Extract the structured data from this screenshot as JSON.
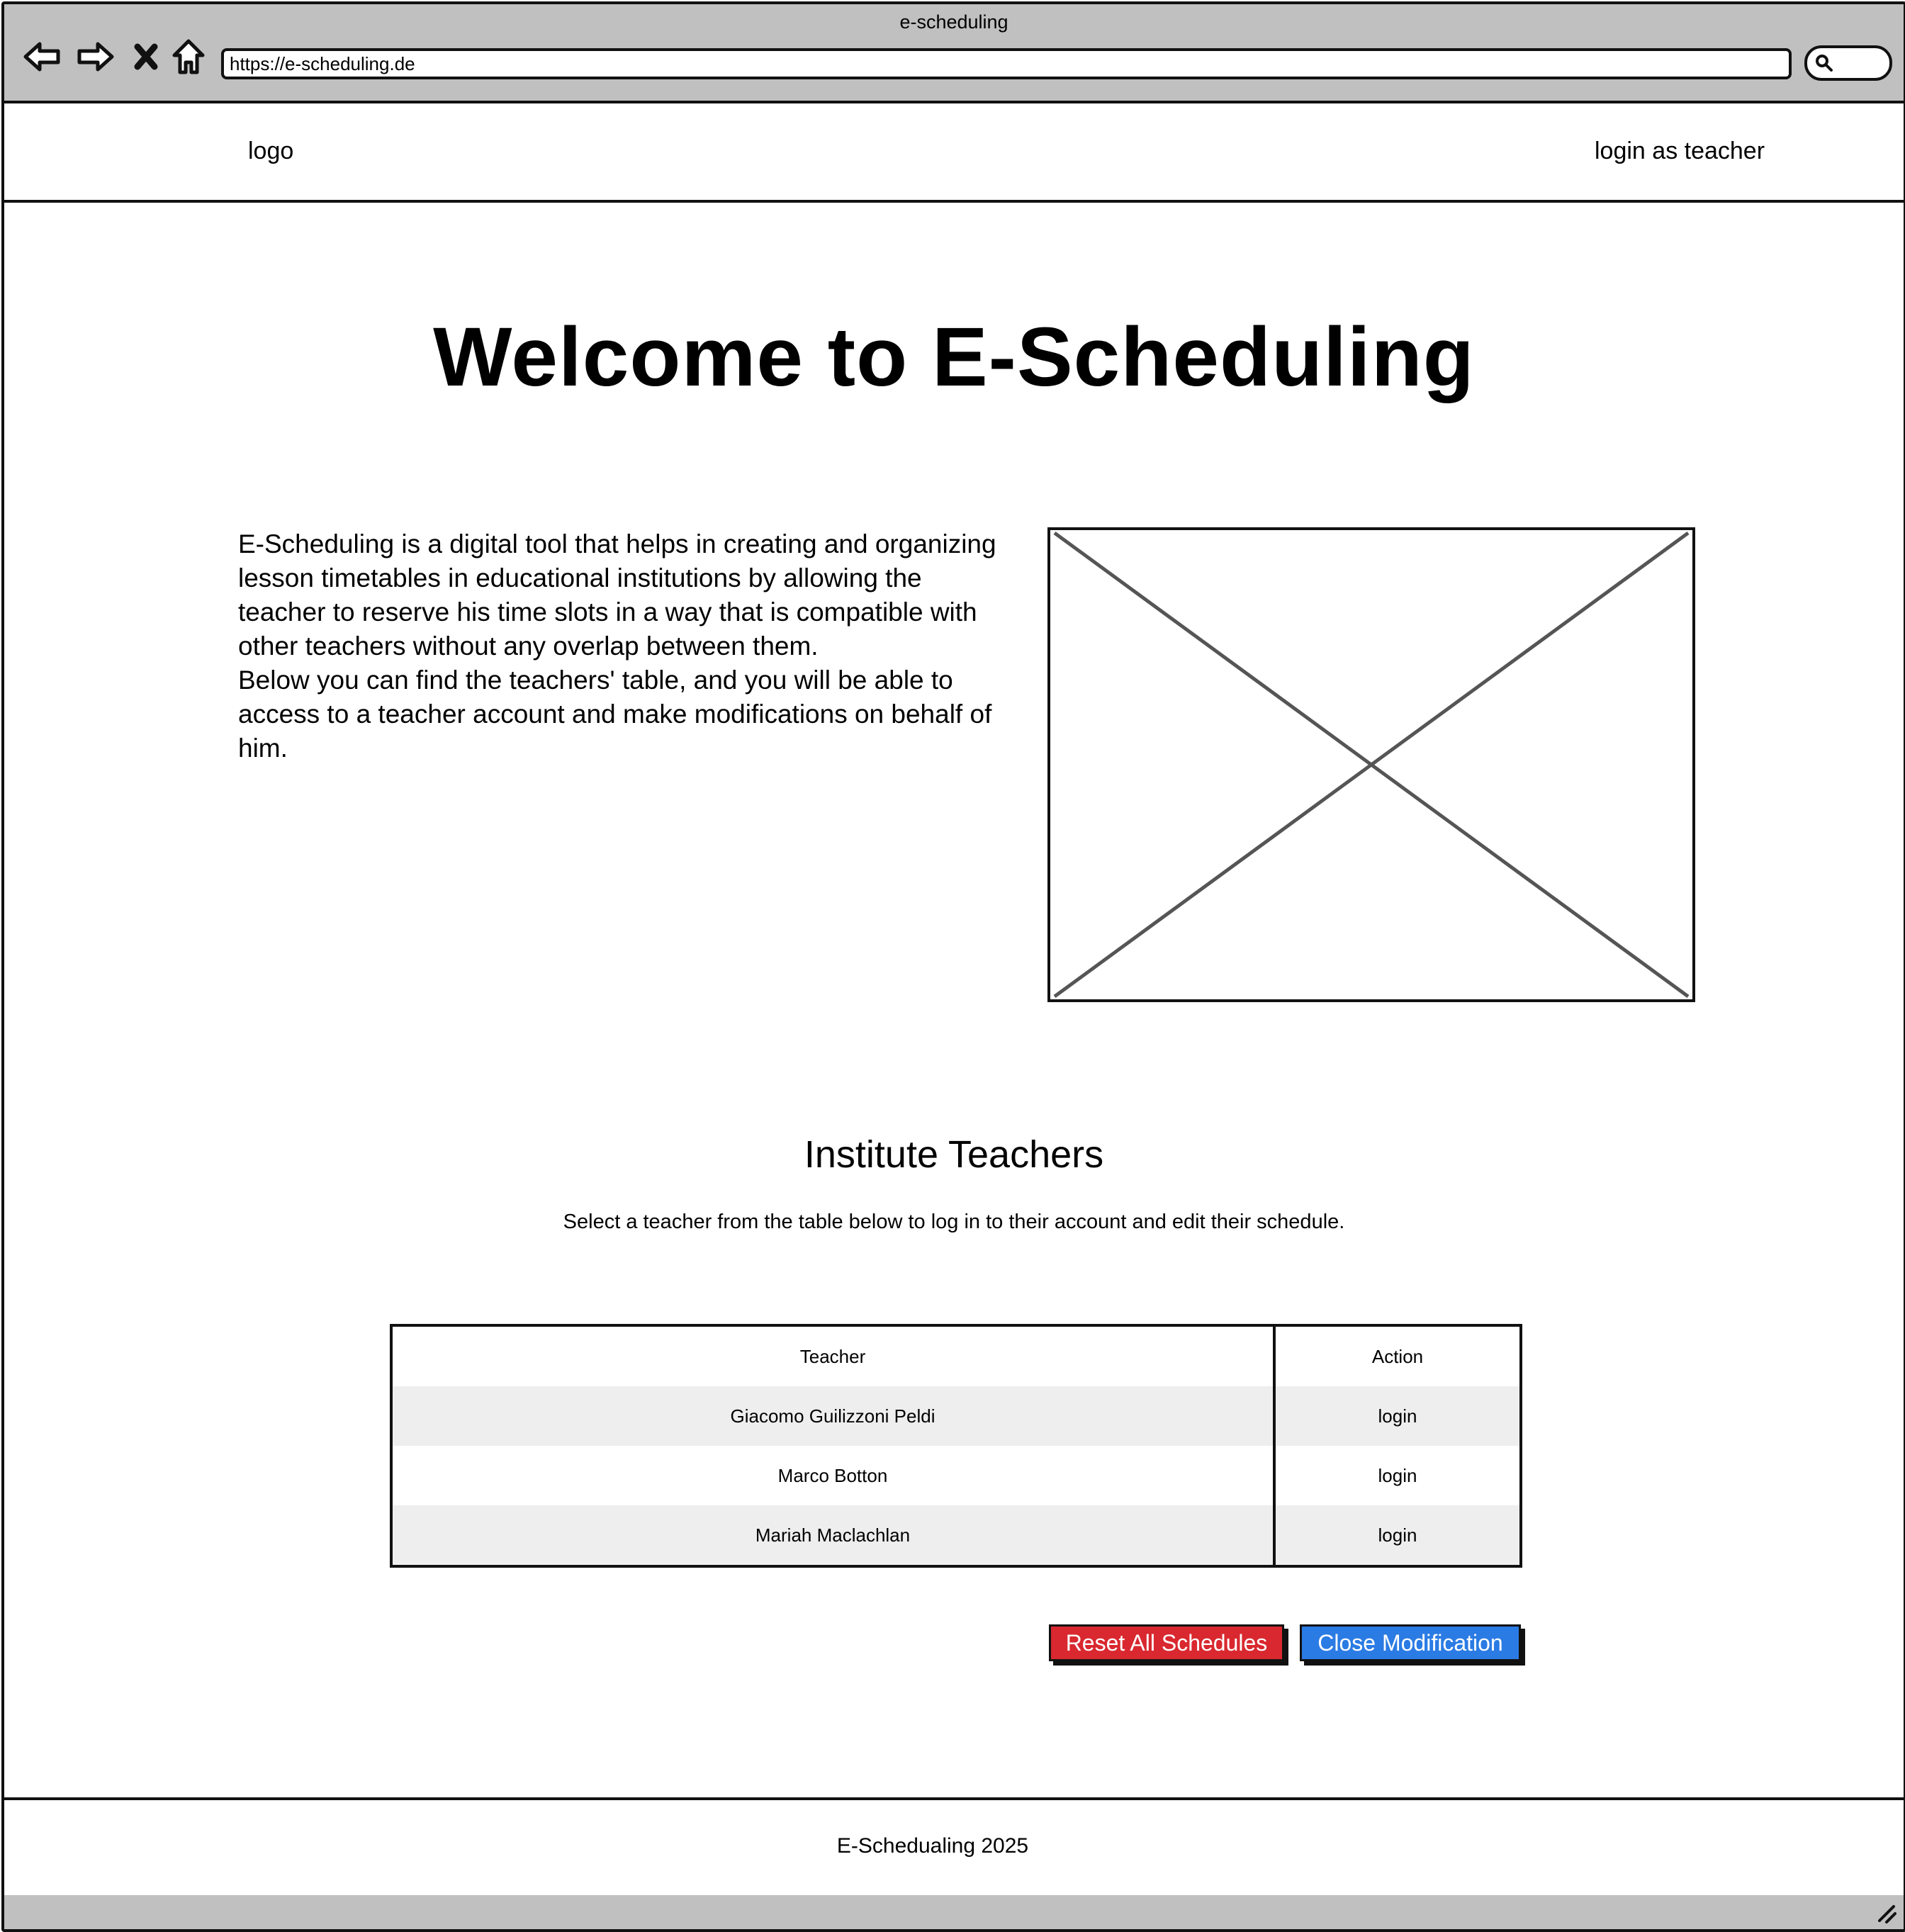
{
  "browser": {
    "window_title": "e-scheduling",
    "url": "https://e-scheduling.de",
    "nav_icons": [
      "back-arrow-icon",
      "forward-arrow-icon",
      "stop-icon",
      "home-icon"
    ],
    "search_icon": "search-icon"
  },
  "header": {
    "logo": "logo",
    "login_link": "login as teacher"
  },
  "main": {
    "title": "Welcome to E-Scheduling",
    "intro_paragraph_1": "E-Scheduling is a digital tool that helps in creating and organizing lesson timetables in educational institutions by allowing the teacher to reserve his time slots in a way that is compatible with other teachers without any overlap between them.",
    "intro_paragraph_2": "Below you can find the teachers' table, and you will be able to access to a teacher account and make modifications on behalf of him.",
    "image_placeholder": "image-placeholder-icon"
  },
  "teachers_section": {
    "title": "Institute Teachers",
    "subtitle": "Select a teacher from the table below to log in to their account and edit their schedule.",
    "columns": [
      "Teacher",
      "Action"
    ],
    "rows": [
      {
        "teacher": "Giacomo Guilizzoni Peldi",
        "action": "login"
      },
      {
        "teacher": "Marco Botton",
        "action": "login"
      },
      {
        "teacher": "Mariah Maclachlan",
        "action": "login"
      }
    ]
  },
  "actions": {
    "reset_label": "Reset All Schedules",
    "close_label": "Close Modification",
    "reset_color": "#d9282f",
    "close_color": "#2b7be4"
  },
  "footer": {
    "text": "E-Schedualing 2025"
  }
}
